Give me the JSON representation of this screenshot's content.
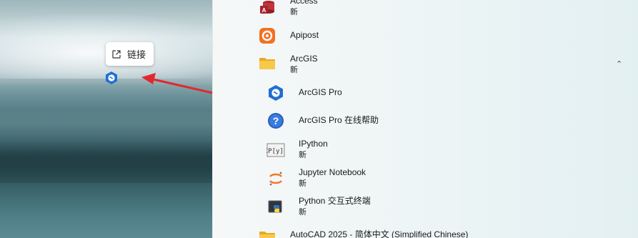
{
  "desktop": {
    "tooltip_label": "链接"
  },
  "start_menu": {
    "apps": [
      {
        "name": "Access",
        "badge": "新",
        "icon": "access-icon"
      },
      {
        "name": "Apipost",
        "badge": "",
        "icon": "apipost-icon"
      },
      {
        "name": "ArcGIS",
        "badge": "新",
        "icon": "folder-icon",
        "expanded": true
      },
      {
        "name": "ArcGIS Pro",
        "badge": "",
        "icon": "arcgis-pro-icon"
      },
      {
        "name": "ArcGIS Pro 在线帮助",
        "badge": "",
        "icon": "help-icon"
      },
      {
        "name": "IPython",
        "badge": "新",
        "icon": "ipython-icon"
      },
      {
        "name": "Jupyter Notebook",
        "badge": "新",
        "icon": "jupyter-icon"
      },
      {
        "name": "Python 交互式终端",
        "badge": "新",
        "icon": "python-icon"
      },
      {
        "name": "AutoCAD 2025 - 简体中文 (Simplified Chinese)",
        "badge": "",
        "icon": "folder-icon"
      }
    ]
  },
  "colors": {
    "arrow": "#e0292e",
    "arcgis_blue": "#1f6fd1",
    "folder": "#f2c14e"
  }
}
